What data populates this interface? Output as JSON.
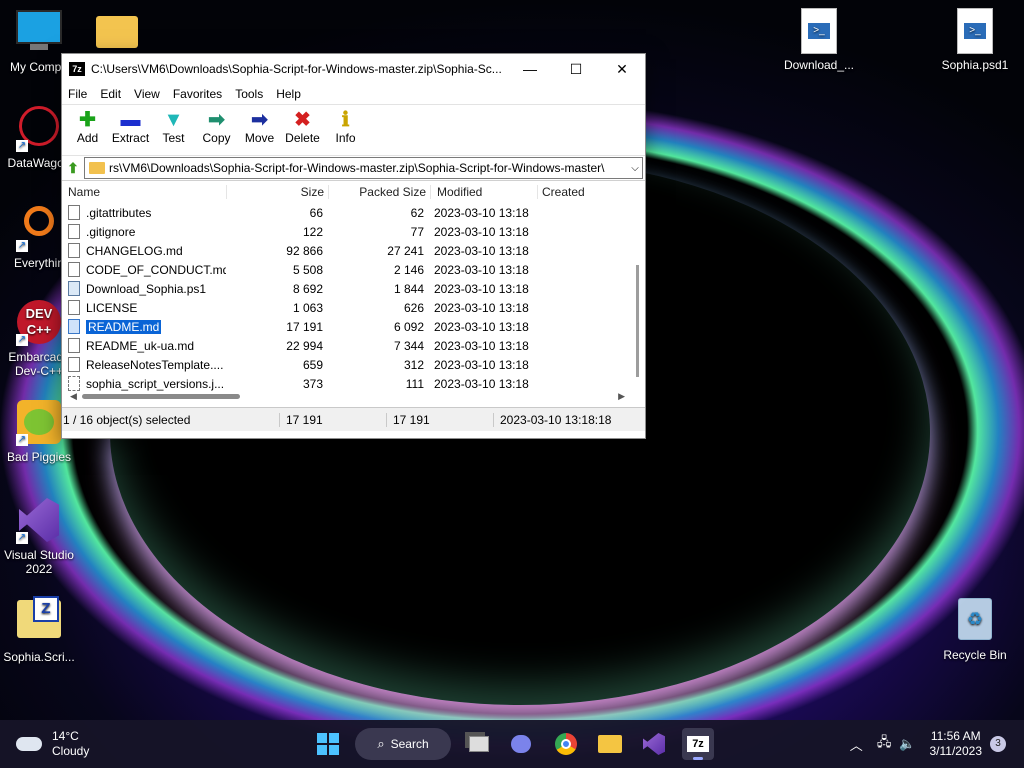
{
  "desktop": {
    "icons": [
      {
        "label": "My Compu",
        "icon": "monitor-icon"
      },
      {
        "label": "DataWagon",
        "icon": "datawagon-icon"
      },
      {
        "label": "Everythin",
        "icon": "everything-icon"
      },
      {
        "label": "Embarcade Dev-C++",
        "icon": "devcpp-icon"
      },
      {
        "label": "Bad Piggies",
        "icon": "bad-piggies-icon"
      },
      {
        "label": "Visual Studio 2022",
        "icon": "visual-studio-icon"
      },
      {
        "label": "Sophia.Scri...",
        "icon": "zip-folder-icon"
      },
      {
        "label": "Download_...",
        "icon": "powershell-file-icon"
      },
      {
        "label": "Sophia.psd1",
        "icon": "powershell-file-icon"
      },
      {
        "label": "Recycle Bin",
        "icon": "recycle-bin-icon"
      }
    ],
    "folder_label": ""
  },
  "window": {
    "app_icon_text": "7z",
    "title": "C:\\Users\\VM6\\Downloads\\Sophia-Script-for-Windows-master.zip\\Sophia-Sc...",
    "minimize": "—",
    "maximize": "☐",
    "close": "✕",
    "menu": [
      "File",
      "Edit",
      "View",
      "Favorites",
      "Tools",
      "Help"
    ],
    "toolbar": [
      {
        "label": "Add",
        "glyph": "✚",
        "color": "#1aa31a"
      },
      {
        "label": "Extract",
        "glyph": "▬",
        "color": "#1c2fcf"
      },
      {
        "label": "Test",
        "glyph": "▼",
        "color": "#1fb7b7"
      },
      {
        "label": "Copy",
        "glyph": "➡",
        "color": "#1f8f6f"
      },
      {
        "label": "Move",
        "glyph": "➡",
        "color": "#1c2f9f"
      },
      {
        "label": "Delete",
        "glyph": "✖",
        "color": "#d42020"
      },
      {
        "label": "Info",
        "glyph": "ℹ",
        "color": "#c9a400"
      }
    ],
    "address": "rs\\VM6\\Downloads\\Sophia-Script-for-Windows-master.zip\\Sophia-Script-for-Windows-master\\",
    "columns": {
      "name": "Name",
      "size": "Size",
      "packed": "Packed Size",
      "modified": "Modified",
      "created": "Created"
    },
    "files": [
      {
        "name": ".gitattributes",
        "size": "66",
        "packed": "62",
        "modified": "2023-03-10 13:18",
        "created": "",
        "type": "file"
      },
      {
        "name": ".gitignore",
        "size": "122",
        "packed": "77",
        "modified": "2023-03-10 13:18",
        "created": "",
        "type": "file"
      },
      {
        "name": "CHANGELOG.md",
        "size": "92 866",
        "packed": "27 241",
        "modified": "2023-03-10 13:18",
        "created": "",
        "type": "file"
      },
      {
        "name": "CODE_OF_CONDUCT.md",
        "size": "5 508",
        "packed": "2 146",
        "modified": "2023-03-10 13:18",
        "created": "",
        "type": "file"
      },
      {
        "name": "Download_Sophia.ps1",
        "size": "8 692",
        "packed": "1 844",
        "modified": "2023-03-10 13:18",
        "created": "",
        "type": "ps"
      },
      {
        "name": "LICENSE",
        "size": "1 063",
        "packed": "626",
        "modified": "2023-03-10 13:18",
        "created": "",
        "type": "file"
      },
      {
        "name": "README.md",
        "size": "17 191",
        "packed": "6 092",
        "modified": "2023-03-10 13:18",
        "created": "",
        "type": "file",
        "selected": true
      },
      {
        "name": "README_uk-ua.md",
        "size": "22 994",
        "packed": "7 344",
        "modified": "2023-03-10 13:18",
        "created": "",
        "type": "file"
      },
      {
        "name": "ReleaseNotesTemplate....",
        "size": "659",
        "packed": "312",
        "modified": "2023-03-10 13:18",
        "created": "",
        "type": "file"
      },
      {
        "name": "sophia_script_versions.j...",
        "size": "373",
        "packed": "111",
        "modified": "2023-03-10 13:18",
        "created": "",
        "type": "json"
      }
    ],
    "status": {
      "selection": "1 / 16 object(s) selected",
      "size": "17 191",
      "packed": "17 191",
      "modified": "2023-03-10 13:18:18"
    }
  },
  "taskbar": {
    "weather_temp": "14°C",
    "weather_desc": "Cloudy",
    "search_label": "Search",
    "time": "11:56 AM",
    "date": "3/11/2023",
    "notifications": "3",
    "apps": [
      "start-icon",
      "task-view-icon",
      "teams-chat-icon",
      "chrome-icon",
      "file-explorer-icon",
      "visual-studio-icon",
      "7zip-icon"
    ]
  }
}
